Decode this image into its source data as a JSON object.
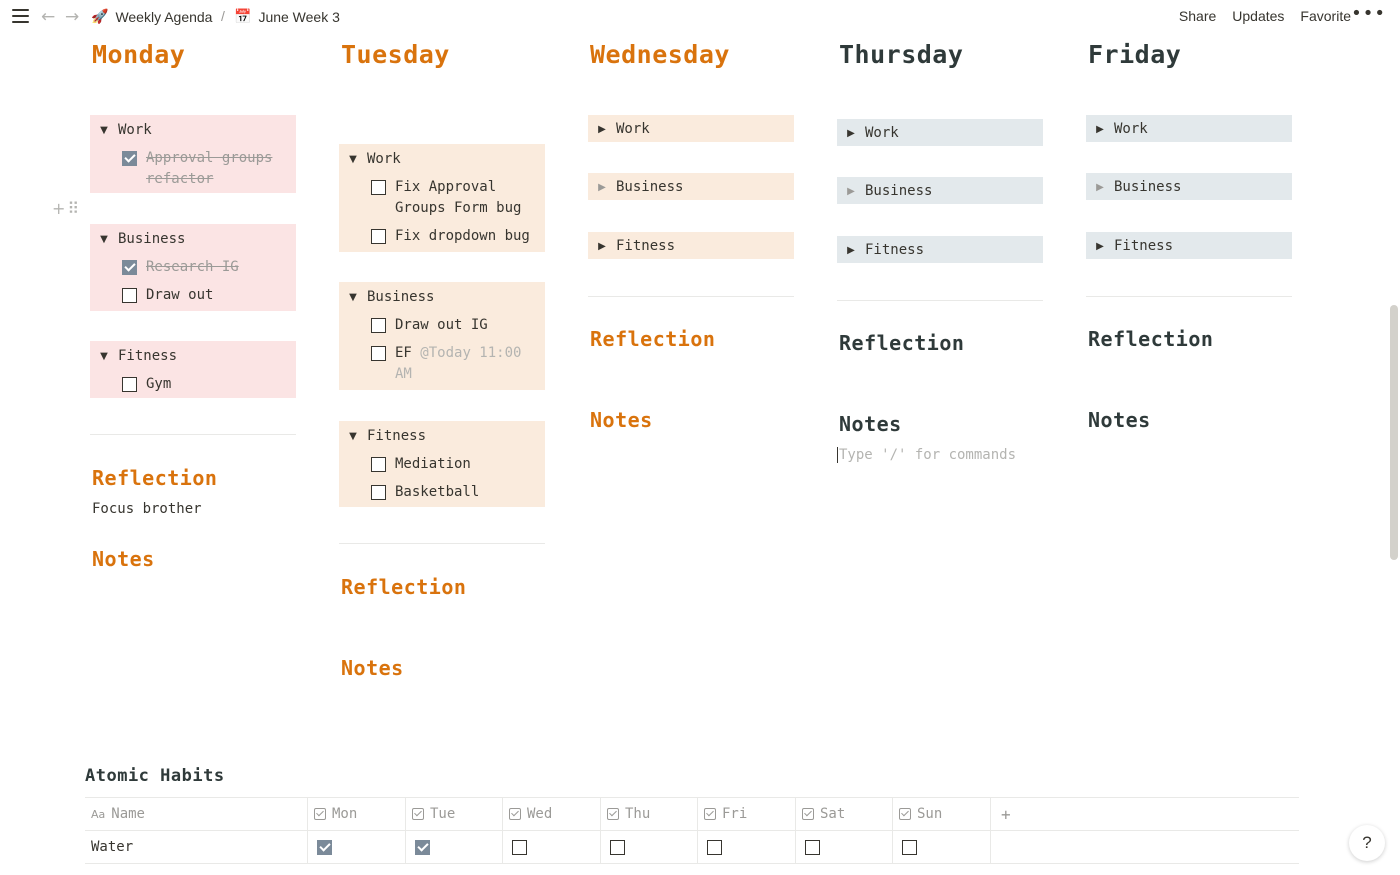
{
  "breadcrumb": {
    "workspace": {
      "icon": "🚀",
      "label": "Weekly Agenda"
    },
    "separator": "/",
    "page": {
      "icon": "📅",
      "label": "June Week 3"
    }
  },
  "header_actions": {
    "share": "Share",
    "updates": "Updates",
    "favorite": "Favorite",
    "more": "•••"
  },
  "days": {
    "monday": {
      "title": "Monday",
      "blocks": {
        "work": {
          "label": "Work",
          "todos": [
            {
              "text": "Approval groups refactor",
              "checked": true
            }
          ]
        },
        "business": {
          "label": "Business",
          "todos": [
            {
              "text": "Research IG",
              "checked": true
            },
            {
              "text": "Draw out",
              "checked": false
            }
          ]
        },
        "fitness": {
          "label": "Fitness",
          "todos": [
            {
              "text": "Gym",
              "checked": false
            }
          ]
        }
      },
      "reflection_title": "Reflection",
      "reflection_text": "Focus brother",
      "notes_title": "Notes"
    },
    "tuesday": {
      "title": "Tuesday",
      "blocks": {
        "work": {
          "label": "Work",
          "todos": [
            {
              "text": "Fix Approval Groups Form bug",
              "checked": false
            },
            {
              "text": "Fix dropdown bug",
              "checked": false
            }
          ]
        },
        "business": {
          "label": "Business",
          "todos": [
            {
              "text": "Draw out IG",
              "checked": false
            },
            {
              "text": "EF",
              "mention": "@Today 11:00 AM",
              "checked": false
            }
          ]
        },
        "fitness": {
          "label": "Fitness",
          "todos": [
            {
              "text": "Mediation",
              "checked": false
            },
            {
              "text": "Basketball",
              "checked": false
            }
          ]
        }
      },
      "reflection_title": "Reflection",
      "notes_title": "Notes"
    },
    "wednesday": {
      "title": "Wednesday",
      "blocks": {
        "work": {
          "label": "Work"
        },
        "business": {
          "label": "Business"
        },
        "fitness": {
          "label": "Fitness"
        }
      },
      "reflection_title": "Reflection",
      "notes_title": "Notes"
    },
    "thursday": {
      "title": "Thursday",
      "blocks": {
        "work": {
          "label": "Work"
        },
        "business": {
          "label": "Business"
        },
        "fitness": {
          "label": "Fitness"
        }
      },
      "reflection_title": "Reflection",
      "notes_title": "Notes",
      "notes_placeholder": "Type '/' for commands"
    },
    "friday": {
      "title": "Friday",
      "blocks": {
        "work": {
          "label": "Work"
        },
        "business": {
          "label": "Business"
        },
        "fitness": {
          "label": "Fitness"
        }
      },
      "reflection_title": "Reflection",
      "notes_title": "Notes"
    }
  },
  "habits": {
    "title": "Atomic Habits",
    "columns": [
      {
        "label": "Name",
        "icon": "Aa"
      },
      {
        "label": "Mon"
      },
      {
        "label": "Tue"
      },
      {
        "label": "Wed"
      },
      {
        "label": "Thu"
      },
      {
        "label": "Fri"
      },
      {
        "label": "Sat"
      },
      {
        "label": "Sun"
      }
    ],
    "add_column": "+",
    "rows": [
      {
        "name": "Water",
        "checks": [
          true,
          true,
          false,
          false,
          false,
          false,
          false
        ]
      }
    ]
  },
  "help": "?",
  "colors": {
    "orange_heading": "#d9730d",
    "dark_heading": "#2f3a3a",
    "pink_block": "#fbe4e4",
    "peach_block": "#faebdd",
    "slate_block": "#e3e9ec",
    "checked_box": "#7b8a99"
  },
  "icons": {
    "menu": "hamburger-icon",
    "back": "arrow-left-icon",
    "forward": "arrow-right-icon",
    "toggle_open": "triangle-down-icon",
    "toggle_closed": "triangle-right-icon",
    "add_block": "plus-icon",
    "drag": "drag-handle-icon"
  }
}
